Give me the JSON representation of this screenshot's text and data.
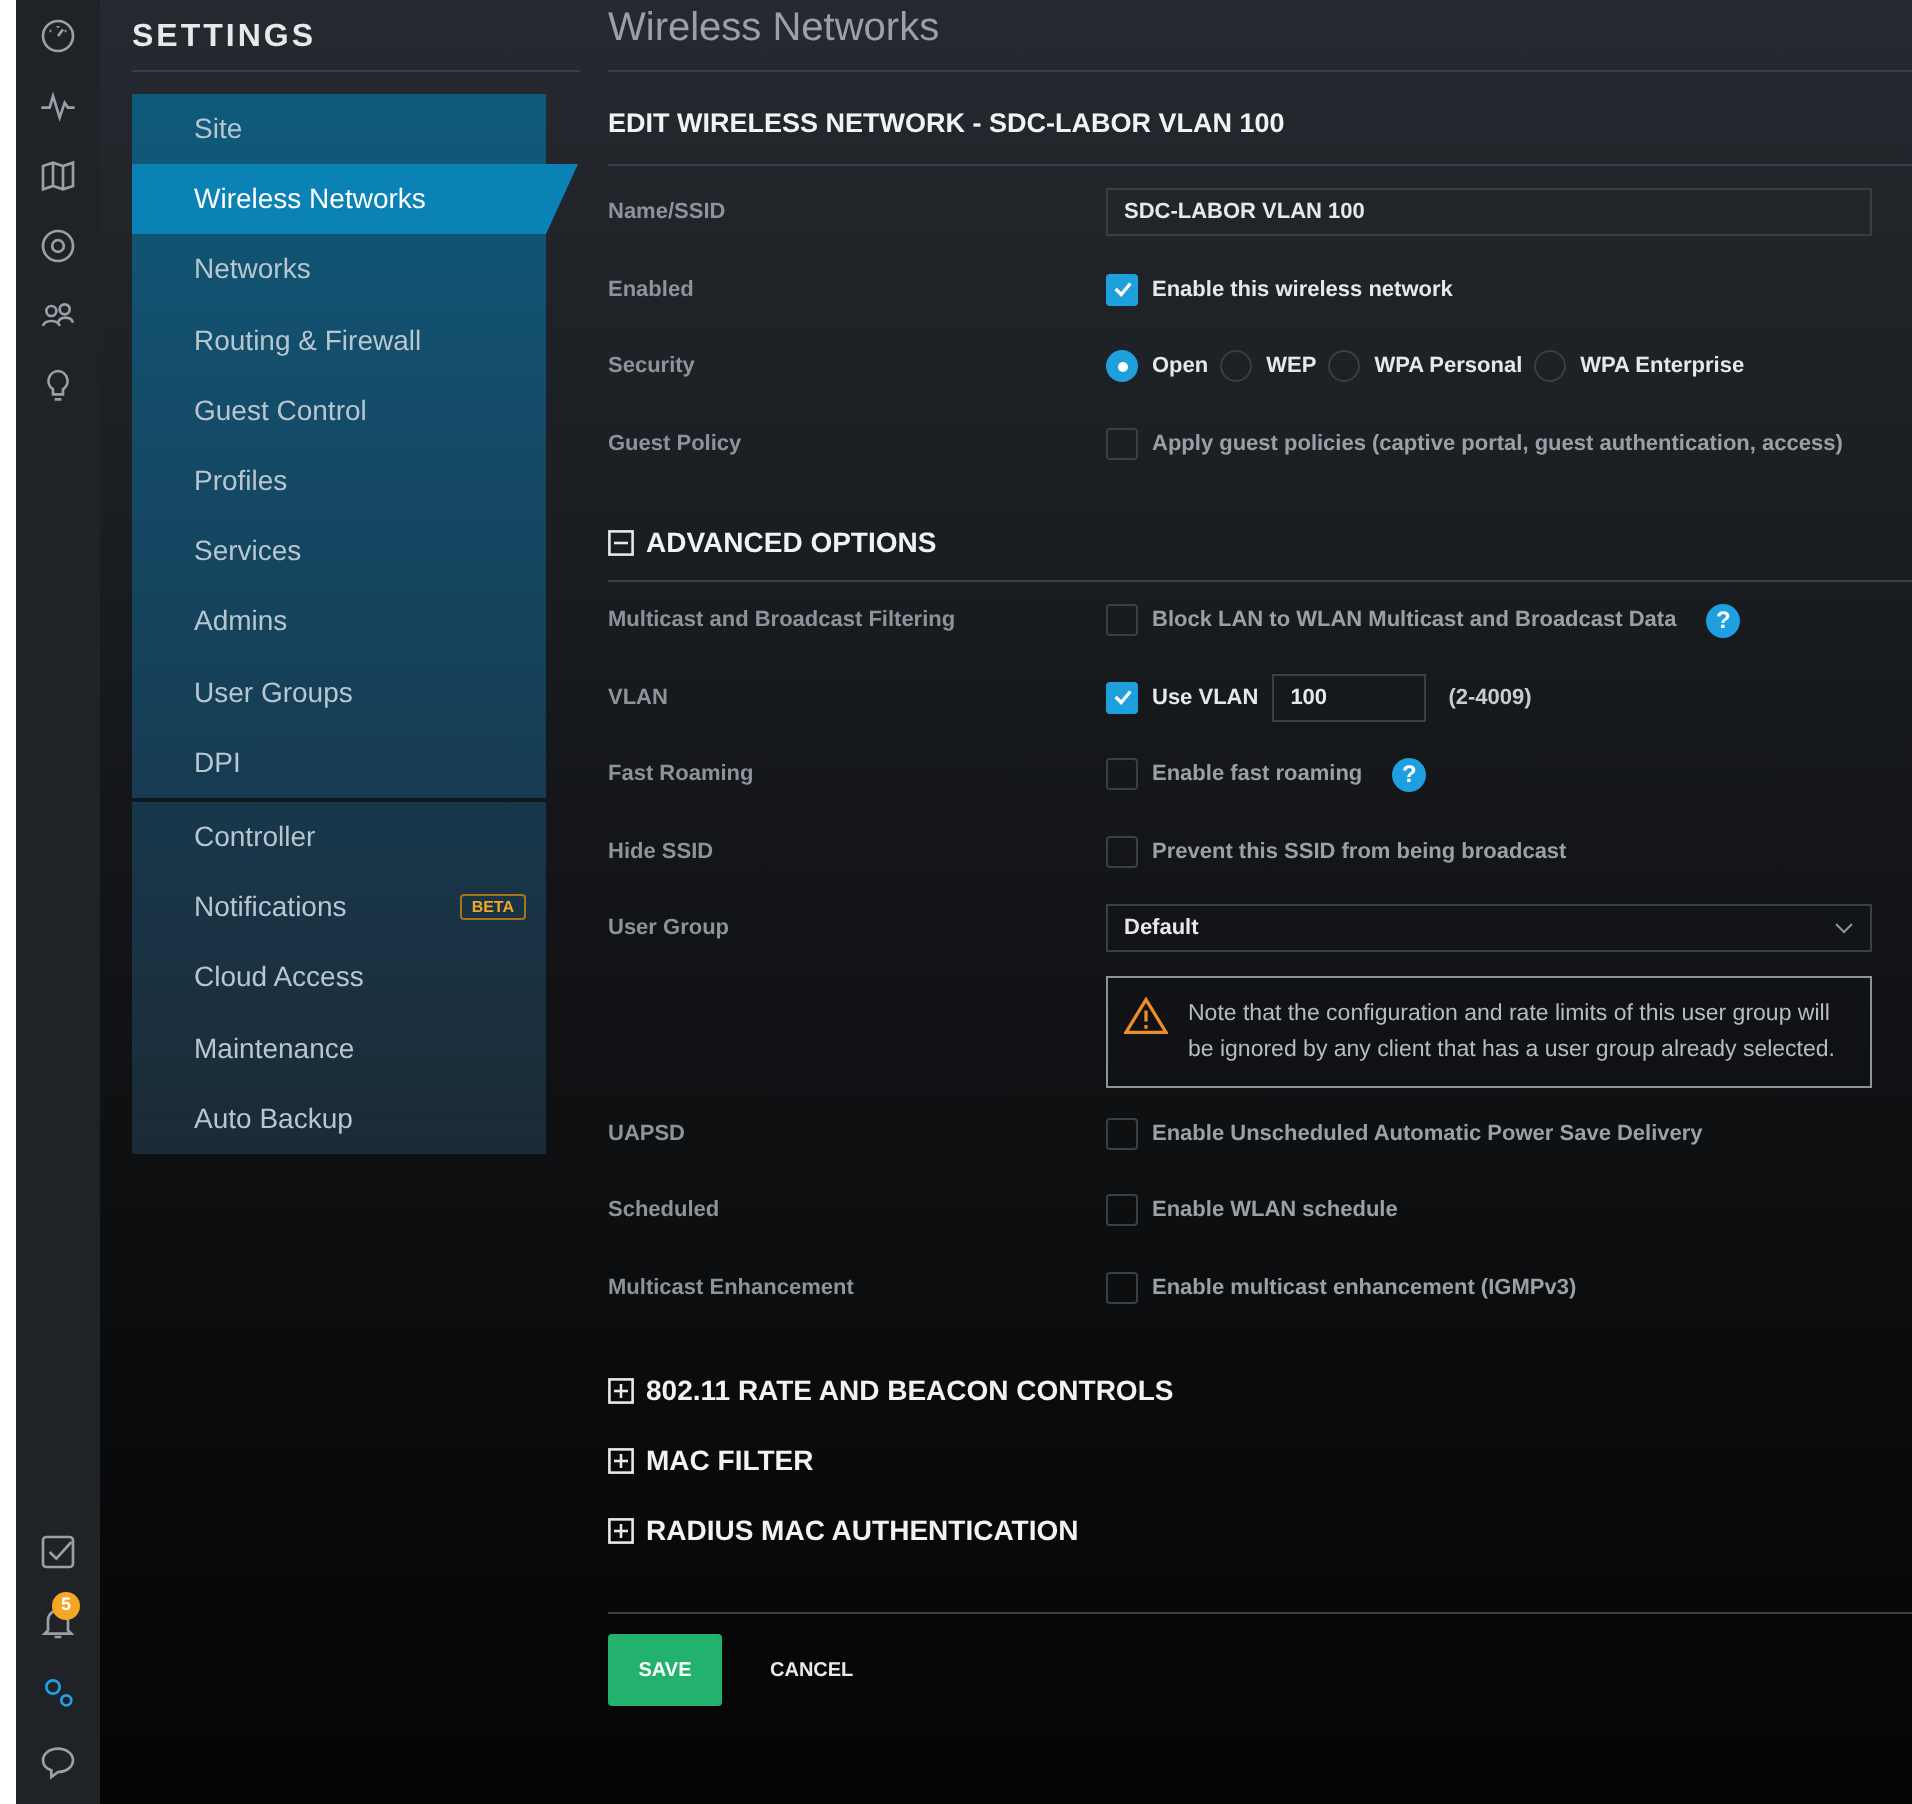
{
  "page_title": "Wireless Networks",
  "rail": {
    "top": [
      {
        "selected": false
      },
      {
        "selected": false
      },
      {
        "selected": false
      },
      {
        "selected": false
      },
      {
        "selected": false
      },
      {
        "selected": false
      }
    ],
    "bottom": [
      {
        "selected": false
      },
      {
        "selected": false,
        "badge": "5"
      },
      {
        "selected": true
      },
      {
        "selected": false
      }
    ]
  },
  "settings": {
    "title": "SETTINGS",
    "groups": [
      [
        {
          "label": "Site",
          "selected": false
        },
        {
          "label": "Wireless Networks",
          "selected": true
        },
        {
          "label": "Networks",
          "selected": false
        },
        {
          "label": "Routing & Firewall",
          "selected": false
        },
        {
          "label": "Guest Control",
          "selected": false
        },
        {
          "label": "Profiles",
          "selected": false
        },
        {
          "label": "Services",
          "selected": false
        },
        {
          "label": "Admins",
          "selected": false
        },
        {
          "label": "User Groups",
          "selected": false
        },
        {
          "label": "DPI",
          "selected": false
        }
      ],
      [
        {
          "label": "Controller",
          "selected": false
        },
        {
          "label": "Notifications",
          "selected": false,
          "badge": "BETA"
        },
        {
          "label": "Cloud Access",
          "selected": false
        },
        {
          "label": "Maintenance",
          "selected": false
        },
        {
          "label": "Auto Backup",
          "selected": false
        }
      ]
    ]
  },
  "form": {
    "title": "EDIT WIRELESS NETWORK - SDC-LABOR VLAN 100",
    "rows": [
      {
        "kind": "text",
        "label": "Name/SSID",
        "value": "SDC-LABOR VLAN 100"
      },
      {
        "kind": "checkbox",
        "label": "Enabled",
        "text": "Enable this wireless network",
        "checked": true
      },
      {
        "kind": "radio",
        "label": "Security",
        "options": [
          {
            "label": "Open",
            "selected": true
          },
          {
            "label": "WEP",
            "selected": false
          },
          {
            "label": "WPA Personal",
            "selected": false
          },
          {
            "label": "WPA Enterprise",
            "selected": false
          }
        ]
      },
      {
        "kind": "checkbox",
        "label": "Guest Policy",
        "text": "Apply guest policies (captive portal, guest authentication, access)",
        "checked": false
      }
    ],
    "advanced": {
      "title": "ADVANCED OPTIONS",
      "expanded": true,
      "rows": [
        {
          "kind": "checkbox",
          "label": "Multicast and Broadcast Filtering",
          "text": "Block LAN to WLAN Multicast and Broadcast Data",
          "checked": false,
          "help": "?"
        },
        {
          "kind": "vlan",
          "label": "VLAN",
          "text": "Use VLAN",
          "checked": true,
          "value": "100",
          "hint": "(2-4009)"
        },
        {
          "kind": "checkbox",
          "label": "Fast Roaming",
          "text": "Enable fast roaming",
          "checked": false,
          "help": "?"
        },
        {
          "kind": "checkbox",
          "label": "Hide SSID",
          "text": "Prevent this SSID from being broadcast",
          "checked": false
        },
        {
          "kind": "select",
          "label": "User Group",
          "value": "Default"
        },
        {
          "kind": "note",
          "text": "Note that the configuration and rate limits of this user group will be ignored by any client that has a user group already selected."
        },
        {
          "kind": "checkbox",
          "label": "UAPSD",
          "text": "Enable Unscheduled Automatic Power Save Delivery",
          "checked": false
        },
        {
          "kind": "checkbox",
          "label": "Scheduled",
          "text": "Enable WLAN schedule",
          "checked": false
        },
        {
          "kind": "checkbox",
          "label": "Multicast Enhancement",
          "text": "Enable multicast enhancement (IGMPv3)",
          "checked": false
        }
      ]
    },
    "sections": [
      {
        "title": "802.11 RATE AND BEACON CONTROLS",
        "expanded": false
      },
      {
        "title": "MAC FILTER",
        "expanded": false
      },
      {
        "title": "RADIUS MAC AUTHENTICATION",
        "expanded": false
      }
    ],
    "buttons": [
      {
        "label": "SAVE",
        "kind": "primary"
      },
      {
        "label": "CANCEL",
        "kind": "plain"
      }
    ]
  }
}
